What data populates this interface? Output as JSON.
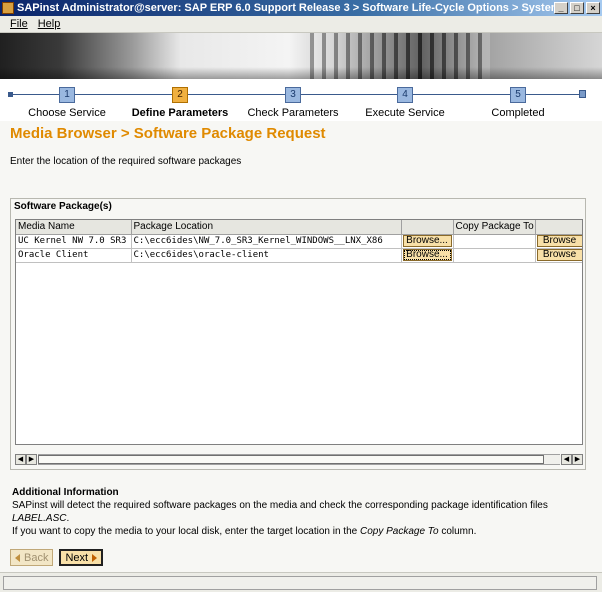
{
  "window": {
    "title": "SAPinst Administrator@server: SAP ERP 6.0 Support Release 3 > Software Life-Cycle Options > System Copy > Oracl...",
    "minimize": "_",
    "maximize": "□",
    "close": "×"
  },
  "menu": {
    "file": "File",
    "help": "Help"
  },
  "steps": [
    {
      "num": "1",
      "label": "Choose Service"
    },
    {
      "num": "2",
      "label": "Define Parameters"
    },
    {
      "num": "3",
      "label": "Check Parameters"
    },
    {
      "num": "4",
      "label": "Execute Service"
    },
    {
      "num": "5",
      "label": "Completed"
    }
  ],
  "page": {
    "title": "Media Browser > Software Package Request",
    "instruction": "Enter the location of the required software packages"
  },
  "packages": {
    "title": "Software Package(s)",
    "columns": [
      "Media Name",
      "Package Location",
      "",
      "Copy Package To",
      ""
    ],
    "rows": [
      {
        "media": "UC Kernel NW 7.0 SR3",
        "location": "C:\\ecc6ides\\NW_7.0_SR3_Kernel_WINDOWS__LNX_X86",
        "browse1": "Browse...",
        "copy_to": "",
        "browse2": "Browse"
      },
      {
        "media": "Oracle Client",
        "location": "C:\\ecc6ides\\oracle-client",
        "browse1": "Browse...",
        "copy_to": "",
        "browse2": "Browse"
      }
    ],
    "scroll_left": "◀",
    "scroll_right": "▶"
  },
  "additional_info": {
    "heading": "Additional Information",
    "line1": "SAPinst will detect the required software packages on the media and check the corresponding package identification files",
    "file": "LABEL.ASC",
    "file_suffix": ".",
    "line2_prefix": "If you want to copy the media to your local disk, enter the target location in the ",
    "line2_col": "Copy Package To",
    "line2_suffix": " column."
  },
  "buttons": {
    "back": "Back",
    "next": "Next"
  },
  "colors": {
    "accent": "#e08a00",
    "button": "#f8e0a8"
  }
}
